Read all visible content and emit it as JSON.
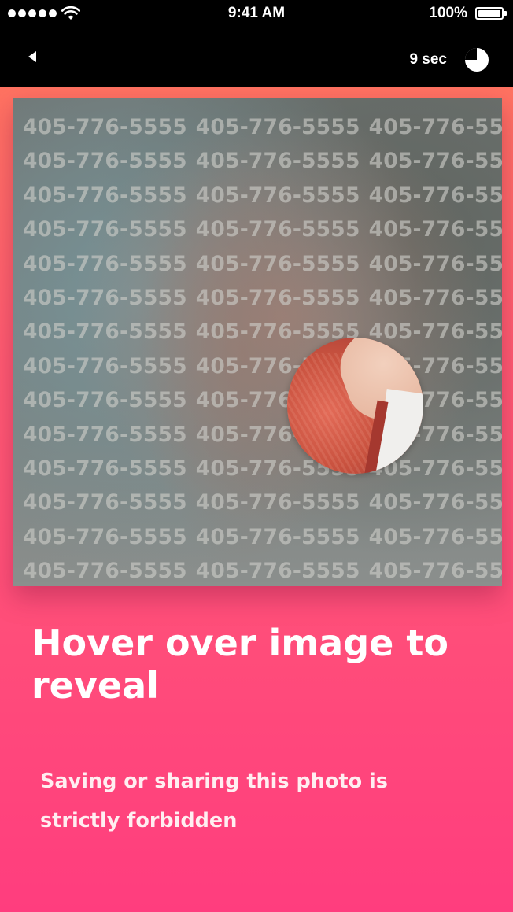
{
  "status_bar": {
    "time": "9:41 AM",
    "battery": "100%",
    "signal_icon": "signal-dots-icon",
    "wifi_icon": "wifi-icon",
    "battery_icon": "battery-full-icon"
  },
  "nav": {
    "back_icon": "back-triangle-icon",
    "timer_label": "9 sec",
    "timer_icon": "pie-timer-icon"
  },
  "photo": {
    "watermark_text": "405-776-5555",
    "reveal_icon": "reveal-lens"
  },
  "content": {
    "headline": "Hover over image to reveal",
    "warning": "Saving or sharing this photo is strictly forbidden"
  },
  "colors": {
    "gradient_top": "#ff7a5c",
    "gradient_bottom": "#ff3d7e",
    "nav_background": "#000000"
  }
}
